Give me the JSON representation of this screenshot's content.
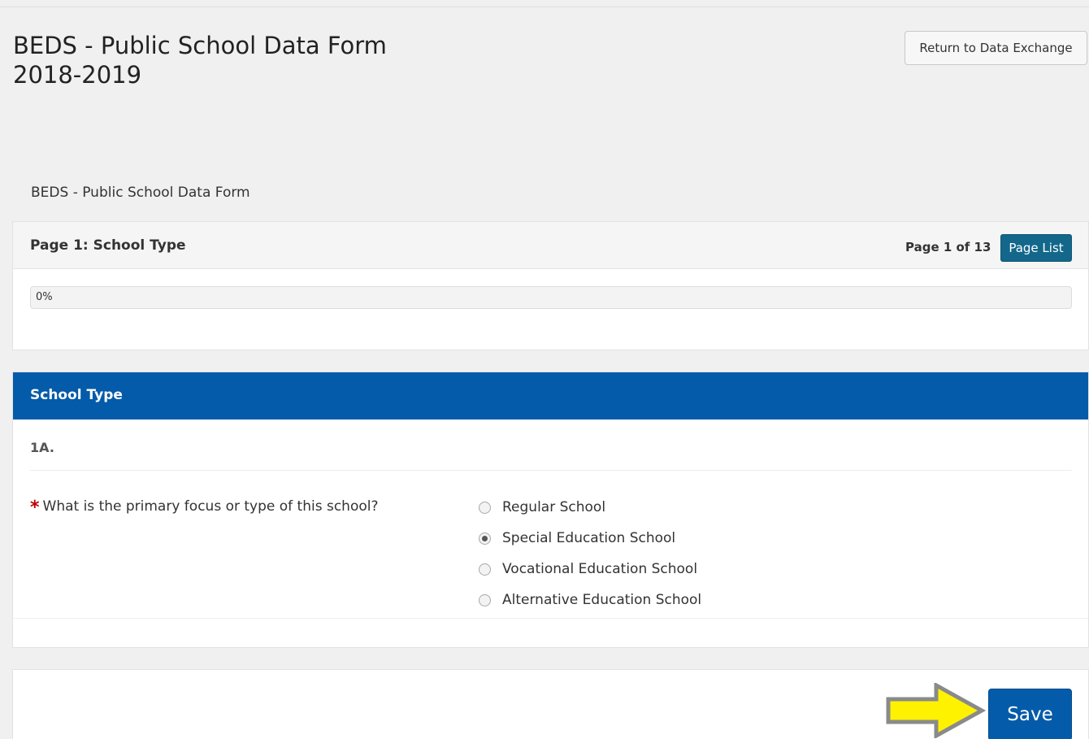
{
  "header": {
    "title_line1": "BEDS - Public School Data Form",
    "title_line2": "2018-2019",
    "return_label": "Return to Data Exchange"
  },
  "form_caption": "BEDS - Public School Data Form",
  "progress_panel": {
    "page_heading": "Page 1: School Type",
    "page_count": "Page 1 of 13",
    "page_list_label": "Page List",
    "progress_text": "0%",
    "progress_fraction": 0
  },
  "section": {
    "title": "School Type",
    "question_number": "1A.",
    "required_marker": "*",
    "question_text": "What is the primary focus or type of this school?",
    "options": [
      {
        "label": "Regular School",
        "selected": false
      },
      {
        "label": "Special Education School",
        "selected": true
      },
      {
        "label": "Vocational Education School",
        "selected": false
      },
      {
        "label": "Alternative Education School",
        "selected": false
      }
    ]
  },
  "footer": {
    "save_label": "Save"
  },
  "colors": {
    "primary_blue": "#045ba9",
    "page_list_teal": "#13678a",
    "required_red": "#c00000",
    "arrow_yellow": "#fff200"
  },
  "icons": {
    "annotation_arrow": "right-arrow-icon"
  }
}
